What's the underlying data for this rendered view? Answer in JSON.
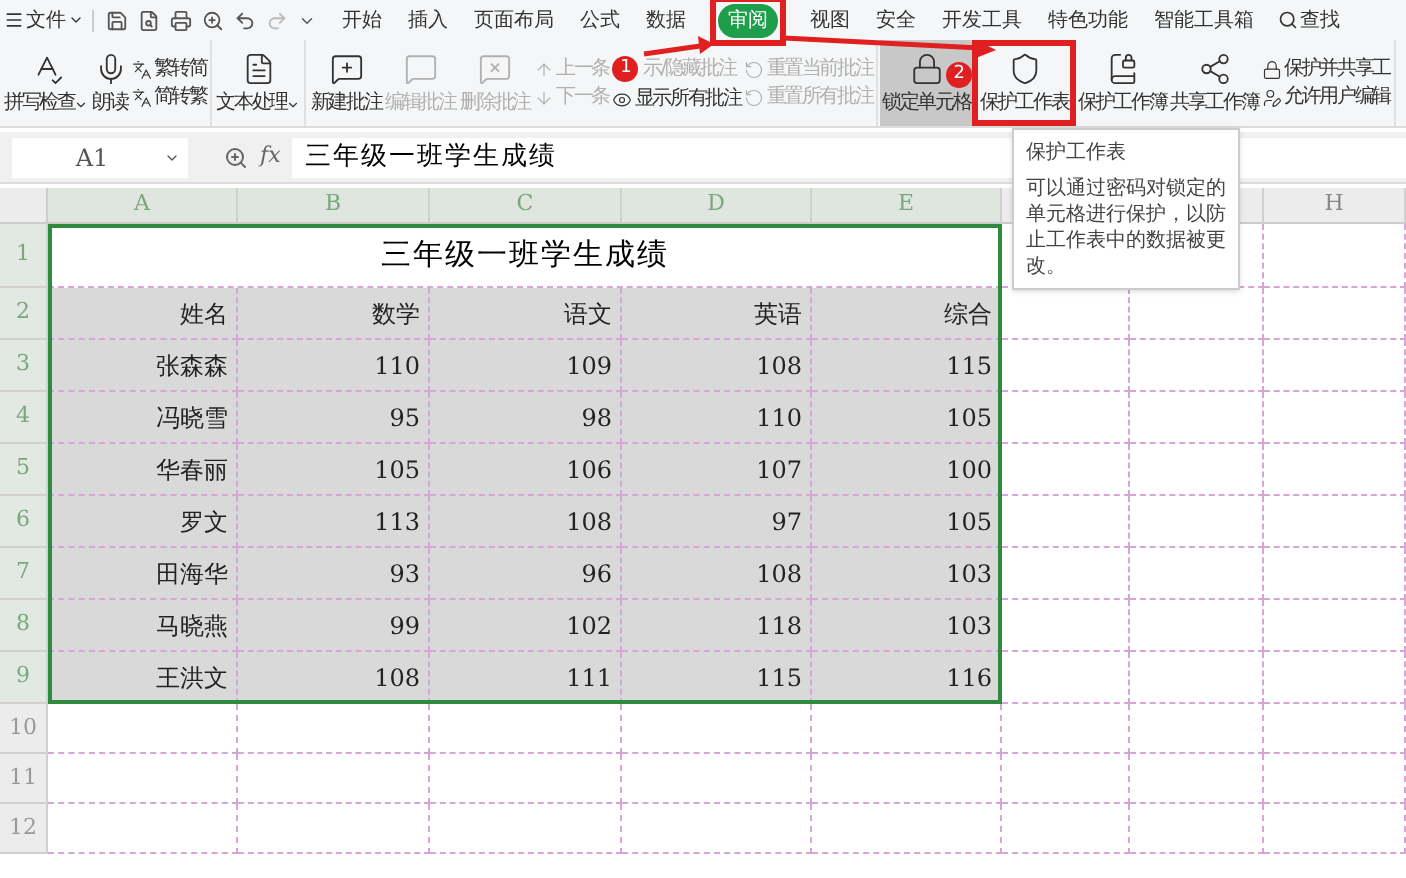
{
  "menu_bar": {
    "file_menu": "文件",
    "tabs": [
      {
        "label": "开始",
        "selected": false
      },
      {
        "label": "插入",
        "selected": false
      },
      {
        "label": "页面布局",
        "selected": false
      },
      {
        "label": "公式",
        "selected": false
      },
      {
        "label": "数据",
        "selected": false,
        "highlighted": false
      },
      {
        "label": "审阅",
        "selected": true,
        "highlighted": true
      },
      {
        "label": "视图",
        "selected": false
      },
      {
        "label": "安全",
        "selected": false
      },
      {
        "label": "开发工具",
        "selected": false
      },
      {
        "label": "特色功能",
        "selected": false
      },
      {
        "label": "智能工具箱",
        "selected": false
      }
    ],
    "search": "查找"
  },
  "ribbon": {
    "groups": [
      [
        {
          "kind": "large",
          "label": "拼写检查",
          "dropdown": true,
          "disabled": false,
          "active": false
        },
        {
          "kind": "large",
          "label": "朗读",
          "dropdown": false,
          "disabled": false,
          "active": false
        },
        {
          "kind": "stack",
          "items": [
            {
              "label": "繁转简",
              "disabled": false
            },
            {
              "label": "简转繁",
              "disabled": false
            }
          ]
        }
      ],
      [
        {
          "kind": "large",
          "label": "文本处理",
          "dropdown": true,
          "disabled": false,
          "active": false
        }
      ],
      [
        {
          "kind": "large",
          "label": "新建批注",
          "dropdown": false,
          "disabled": false,
          "active": false
        },
        {
          "kind": "large",
          "label": "编辑批注",
          "dropdown": false,
          "disabled": true,
          "active": false
        },
        {
          "kind": "large",
          "label": "删除批注",
          "dropdown": false,
          "disabled": true,
          "active": false
        },
        {
          "kind": "stack",
          "items": [
            {
              "label": "上一条",
              "disabled": true
            },
            {
              "label": "下一条",
              "disabled": true
            }
          ]
        },
        {
          "kind": "stack",
          "items": [
            {
              "label": "示/隐藏批注",
              "disabled": true
            },
            {
              "label": "显示所有批注",
              "disabled": false
            }
          ]
        },
        {
          "kind": "stack",
          "items": [
            {
              "label": "重置当前批注",
              "disabled": true
            },
            {
              "label": "重置所有批注",
              "disabled": true
            }
          ]
        }
      ],
      [
        {
          "kind": "large",
          "label": "锁定单元格",
          "dropdown": false,
          "disabled": false,
          "active": true
        },
        {
          "kind": "large",
          "label": "保护工作表",
          "dropdown": false,
          "disabled": false,
          "active": false,
          "highlighted": true
        },
        {
          "kind": "large",
          "label": "保护工作簿",
          "dropdown": false,
          "disabled": false,
          "active": false
        },
        {
          "kind": "large",
          "label": "共享工作簿",
          "dropdown": false,
          "disabled": false,
          "active": false
        },
        {
          "kind": "stack",
          "items": [
            {
              "label": "保护并共享工",
              "disabled": false
            },
            {
              "label": "允许用户编辑",
              "disabled": false
            }
          ]
        }
      ]
    ]
  },
  "formula_bar": {
    "name_box": "A1",
    "fx": "fx",
    "formula": "三年级一班学生成绩"
  },
  "column_headers": [
    "A",
    "B",
    "C",
    "D",
    "E",
    "H"
  ],
  "row_numbers": [
    "1",
    "2",
    "3",
    "4",
    "5",
    "6",
    "7",
    "8",
    "9",
    "10",
    "11",
    "12"
  ],
  "sheet": {
    "title": "三年级一班学生成绩",
    "header": [
      "姓名",
      "数学",
      "语文",
      "英语",
      "综合"
    ],
    "rows": [
      [
        "张森森",
        "110",
        "109",
        "108",
        "115"
      ],
      [
        "冯晓雪",
        "95",
        "98",
        "110",
        "105"
      ],
      [
        "华春丽",
        "105",
        "106",
        "107",
        "100"
      ],
      [
        "罗文",
        "113",
        "108",
        "97",
        "105"
      ],
      [
        "田海华",
        "93",
        "96",
        "108",
        "103"
      ],
      [
        "马晓燕",
        "99",
        "102",
        "118",
        "103"
      ],
      [
        "王洪文",
        "108",
        "111",
        "115",
        "116"
      ]
    ]
  },
  "callouts": [
    "1",
    "2"
  ],
  "tooltip": {
    "title": "保护工作表",
    "text": "可以通过密码对锁定的单元格进行保护，以防止工作表中的数据被更改。"
  }
}
